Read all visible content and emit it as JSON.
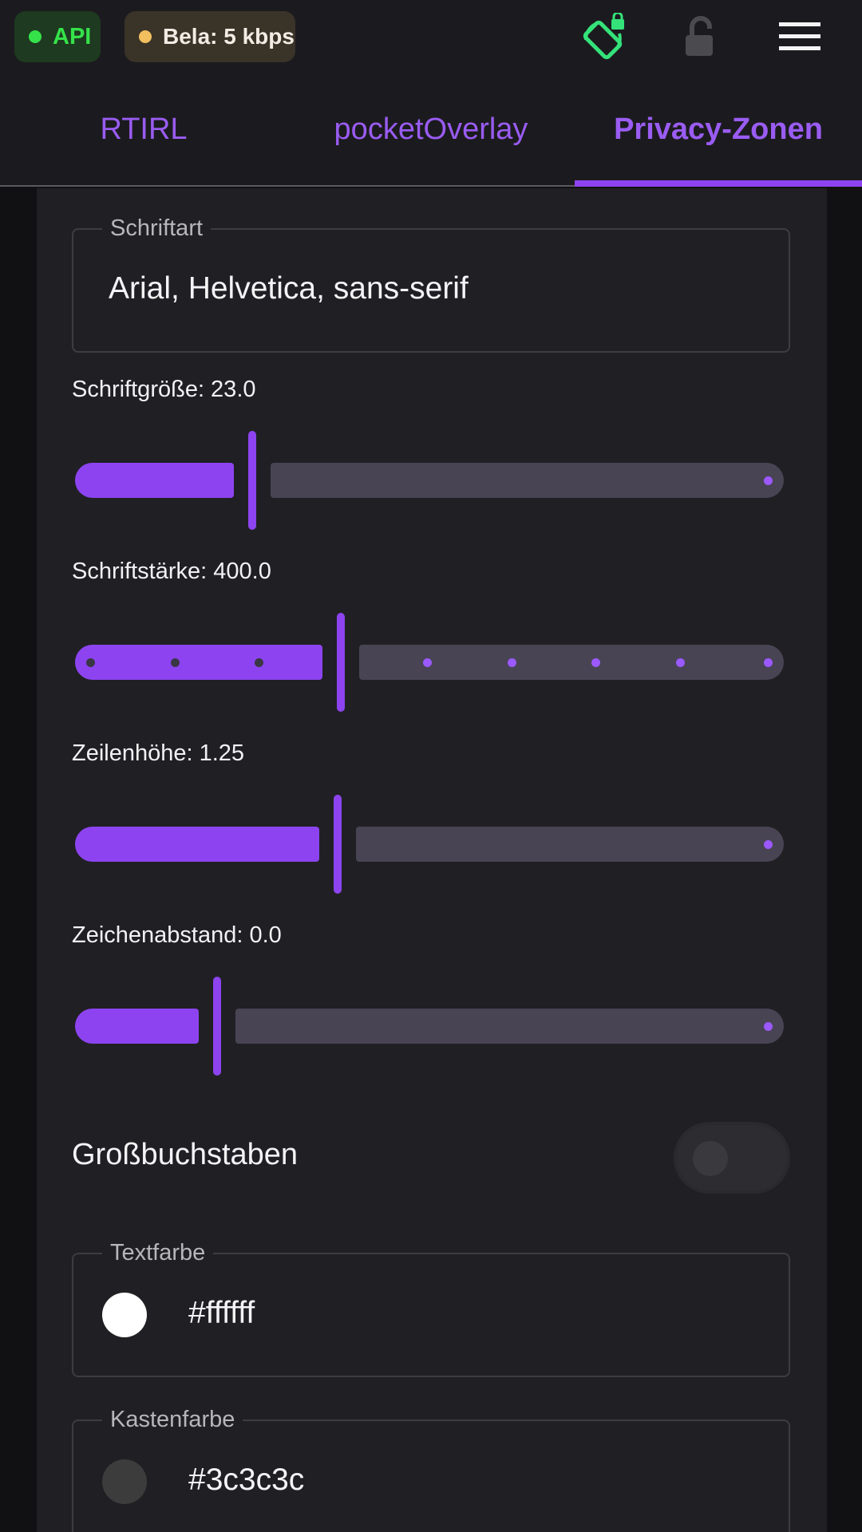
{
  "status": {
    "api_label": "API",
    "api_color": "#35e24a",
    "bela_label": "Bela: 5 kbps",
    "bela_dot_color": "#f2bf5f",
    "icons": [
      "screen-rotation-lock-icon",
      "unlock-icon",
      "menu-icon"
    ]
  },
  "tabs": [
    {
      "label": "RTIRL",
      "active": false
    },
    {
      "label": "pocketOverlay",
      "active": false
    },
    {
      "label": "Privacy-Zonen",
      "active": true
    }
  ],
  "accent_color": "#8d44f0",
  "font_field": {
    "legend": "Schriftart",
    "value": "Arial, Helvetica, sans-serif"
  },
  "sliders": [
    {
      "label": "Schriftgröße: 23.0",
      "fraction": 0.25
    },
    {
      "label": "Schriftstärke: 400.0",
      "fraction": 0.375
    },
    {
      "label": "Zeilenhöhe: 1.25",
      "fraction": 0.37
    },
    {
      "label": "Zeichenabstand: 0.0",
      "fraction": 0.2
    }
  ],
  "uppercase_toggle": {
    "label": "Großbuchstaben",
    "on": false
  },
  "text_color": {
    "legend": "Textfarbe",
    "value": "#ffffff",
    "swatch": "#ffffff"
  },
  "box_color": {
    "legend": "Kastenfarbe",
    "value": "#3c3c3c",
    "swatch": "#3c3c3c"
  }
}
